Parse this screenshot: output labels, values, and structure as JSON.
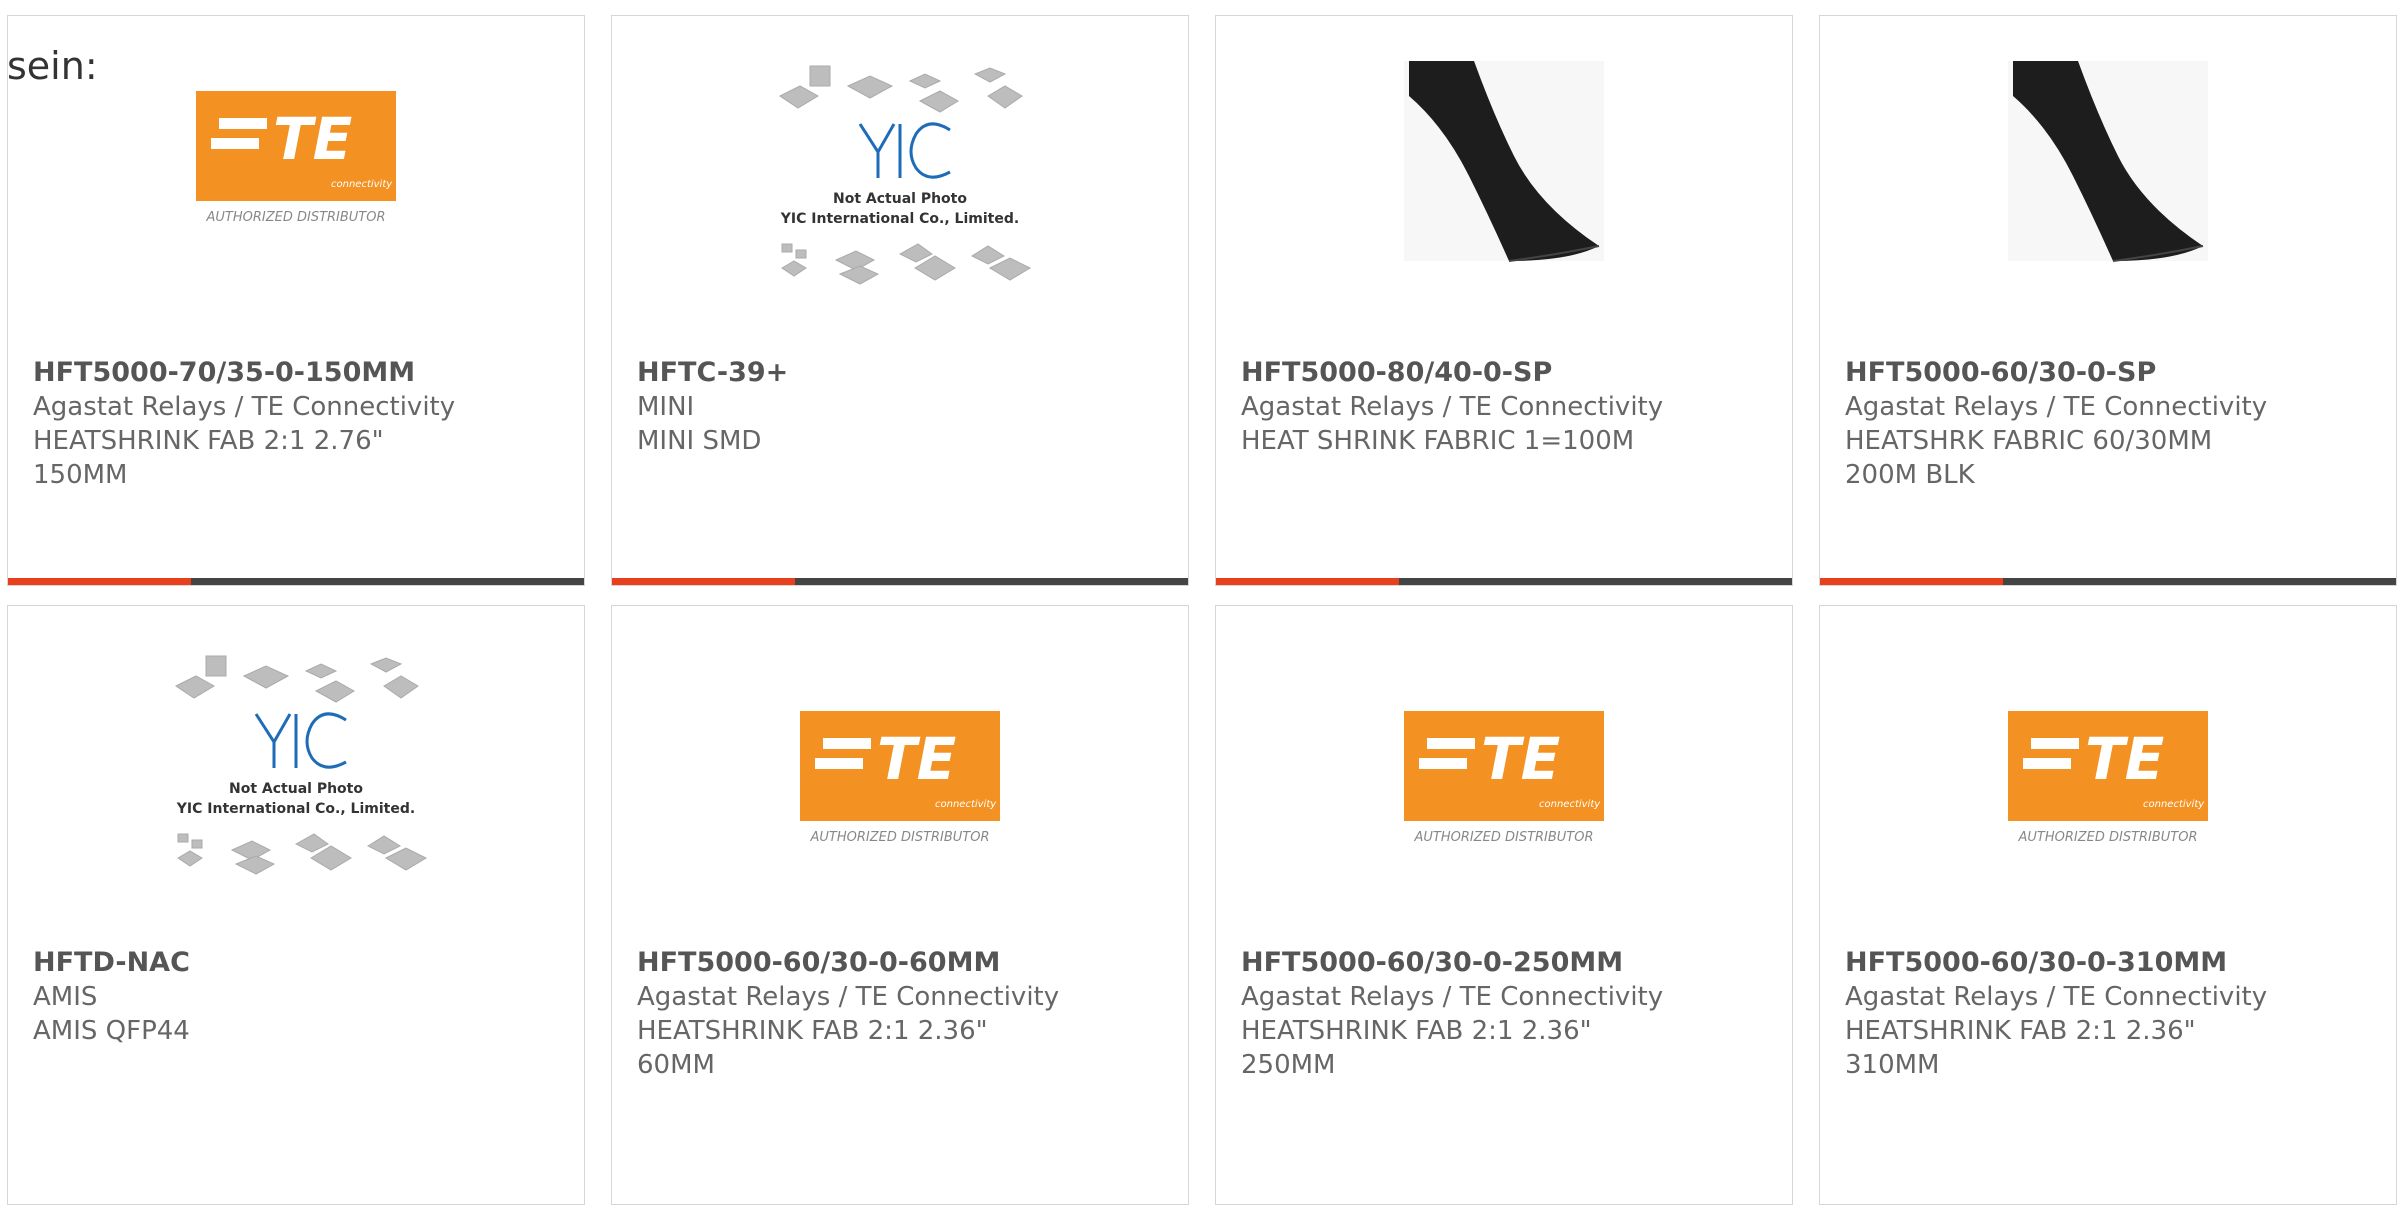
{
  "page": {
    "cut_text": "sein:"
  },
  "colors": {
    "accent": "#e8401c",
    "te_orange": "#f39223",
    "bar_dark": "#444444",
    "text": "#666666"
  },
  "products": [
    {
      "image": "te-logo",
      "logo_text": "TE",
      "logo_sub": "connectivity",
      "logo_caption": "AUTHORIZED DISTRIBUTOR",
      "part_number": "HFT5000-70/35-0-150MM",
      "manufacturer": "Agastat Relays / TE Connectivity",
      "description": "HEATSHRINK FAB 2:1 2.76\"",
      "extra": "150MM"
    },
    {
      "image": "yic-placeholder",
      "logo_caption": "Not Actual Photo",
      "logo_caption2": "YIC International Co., Limited.",
      "part_number": "HFTC-39+",
      "manufacturer": "MINI",
      "description": "MINI SMD",
      "extra": ""
    },
    {
      "image": "heatshrink-photo",
      "part_number": "HFT5000-80/40-0-SP",
      "manufacturer": "Agastat Relays / TE Connectivity",
      "description": "HEAT SHRINK FABRIC 1=100M",
      "extra": ""
    },
    {
      "image": "heatshrink-photo",
      "part_number": "HFT5000-60/30-0-SP",
      "manufacturer": "Agastat Relays / TE Connectivity",
      "description": "HEATSHRK FABRIC 60/30MM",
      "extra": "200M BLK"
    },
    {
      "image": "yic-placeholder",
      "logo_caption": "Not Actual Photo",
      "logo_caption2": "YIC International Co., Limited.",
      "part_number": "HFTD-NAC",
      "manufacturer": "AMIS",
      "description": "AMIS QFP44",
      "extra": ""
    },
    {
      "image": "te-logo",
      "logo_text": "TE",
      "logo_sub": "connectivity",
      "logo_caption": "AUTHORIZED DISTRIBUTOR",
      "part_number": "HFT5000-60/30-0-60MM",
      "manufacturer": "Agastat Relays / TE Connectivity",
      "description": "HEATSHRINK FAB 2:1 2.36\"",
      "extra": "60MM"
    },
    {
      "image": "te-logo",
      "logo_text": "TE",
      "logo_sub": "connectivity",
      "logo_caption": "AUTHORIZED DISTRIBUTOR",
      "part_number": "HFT5000-60/30-0-250MM",
      "manufacturer": "Agastat Relays / TE Connectivity",
      "description": "HEATSHRINK FAB 2:1 2.36\"",
      "extra": "250MM"
    },
    {
      "image": "te-logo",
      "logo_text": "TE",
      "logo_sub": "connectivity",
      "logo_caption": "AUTHORIZED DISTRIBUTOR",
      "part_number": "HFT5000-60/30-0-310MM",
      "manufacturer": "Agastat Relays / TE Connectivity",
      "description": "HEATSHRINK FAB 2:1 2.36\"",
      "extra": "310MM"
    }
  ]
}
